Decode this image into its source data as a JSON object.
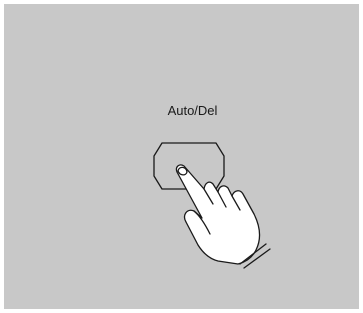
{
  "button": {
    "label": "Auto/Del",
    "shape": "octagon",
    "state": "being-pressed"
  },
  "pointer": {
    "icon": "pointing-hand-icon"
  },
  "colors": {
    "panel_background": "#c8c8c8",
    "outline": "#1a1a1a",
    "hand_fill": "#ffffff"
  }
}
